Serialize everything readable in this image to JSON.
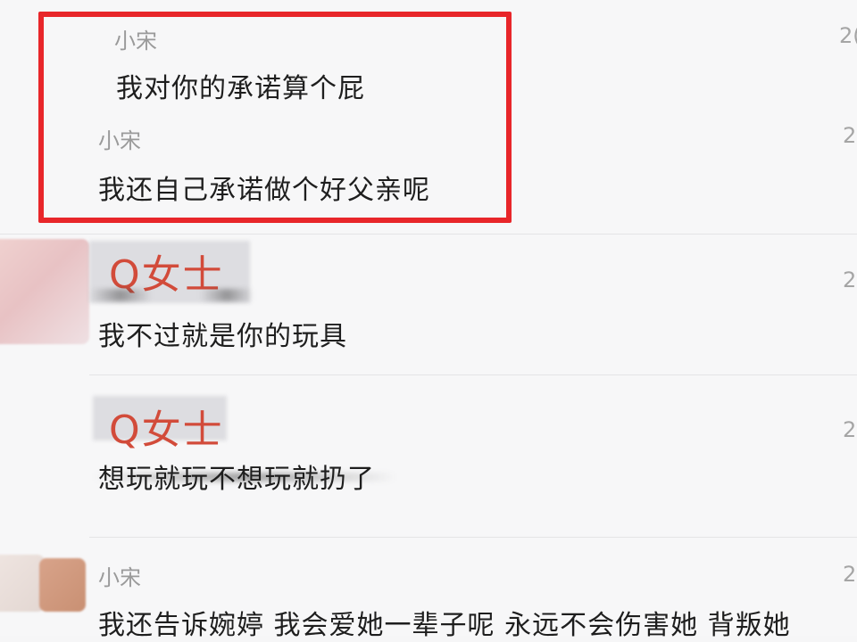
{
  "messages": [
    {
      "sender": "小宋",
      "text": "我对你的承诺算个屁",
      "time": "2("
    },
    {
      "sender": "小宋",
      "text": "我还自己承诺做个好父亲呢",
      "time": "2"
    },
    {
      "sender": "Q女士",
      "text": "我不过就是你的玩具",
      "time": "2"
    },
    {
      "sender": "Q女士",
      "text": "想玩就玩不想玩就扔了",
      "time": "2"
    },
    {
      "sender": "小宋",
      "text": "我还告诉婉婷 我会爱她一辈子呢 永远不会伤害她 背叛她",
      "time": "2"
    }
  ],
  "colors": {
    "highlight_border": "#e8262a",
    "q_name": "#d24b3a",
    "sender_grey": "#9a9a9a"
  }
}
